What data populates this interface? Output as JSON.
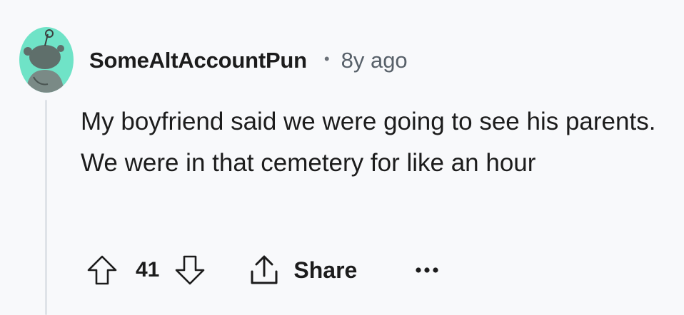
{
  "comment": {
    "author": "SomeAltAccountPun",
    "separator": "•",
    "timestamp": "8y ago",
    "body": "My boyfriend said we were going to see his parents. We were in that cemetery for like an hour",
    "score": "41",
    "share_label": "Share"
  },
  "icons": {
    "avatar": "snoo-avatar-icon",
    "upvote": "arrow-up-icon",
    "downvote": "arrow-down-icon",
    "share": "share-upload-icon",
    "more": "ellipsis-icon"
  },
  "colors": {
    "background": "#f8f9fb",
    "avatar_bg": "#6fe3c7",
    "text": "#1c1c1c",
    "muted": "#576069",
    "thread_line": "#dfe3e8"
  }
}
